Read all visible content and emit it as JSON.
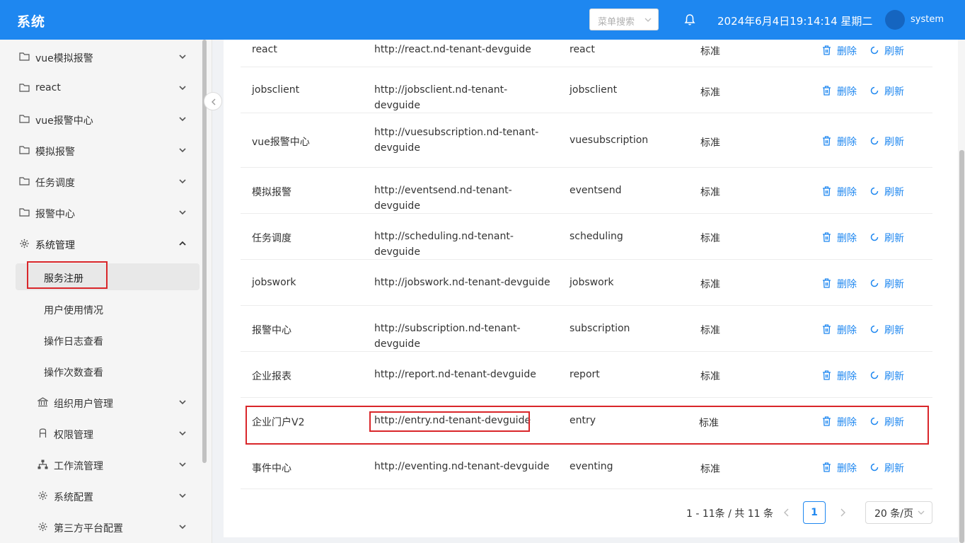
{
  "header": {
    "brand": "系统",
    "menu_search_placeholder": "菜单搜索",
    "datetime": "2024年6月4日19:14:14 星期二",
    "username": "system"
  },
  "sidebar": {
    "items": [
      {
        "label": "vue模拟报警"
      },
      {
        "label": "react"
      },
      {
        "label": "vue报警中心"
      },
      {
        "label": "模拟报警"
      },
      {
        "label": "任务调度"
      },
      {
        "label": "报警中心"
      },
      {
        "label": "系统管理"
      },
      {
        "label": "服务注册"
      },
      {
        "label": "用户使用情况"
      },
      {
        "label": "操作日志查看"
      },
      {
        "label": "操作次数查看"
      },
      {
        "label": "组织用户管理"
      },
      {
        "label": "权限管理"
      },
      {
        "label": "工作流管理"
      },
      {
        "label": "系统配置"
      },
      {
        "label": "第三方平台配置"
      }
    ]
  },
  "table": {
    "rows": [
      {
        "name": "react",
        "url": "http://react.nd-tenant-devguide",
        "code": "react",
        "type": "标准"
      },
      {
        "name": "jobsclient",
        "url": "http://jobsclient.nd-tenant-devguide",
        "code": "jobsclient",
        "type": "标准"
      },
      {
        "name": "vue报警中心",
        "url": "http://vuesubscription.nd-tenant-devguide",
        "code": "vuesubscription",
        "type": "标准"
      },
      {
        "name": "模拟报警",
        "url": "http://eventsend.nd-tenant-devguide",
        "code": "eventsend",
        "type": "标准"
      },
      {
        "name": "任务调度",
        "url": "http://scheduling.nd-tenant-devguide",
        "code": "scheduling",
        "type": "标准"
      },
      {
        "name": "jobswork",
        "url": "http://jobswork.nd-tenant-devguide",
        "code": "jobswork",
        "type": "标准"
      },
      {
        "name": "报警中心",
        "url": "http://subscription.nd-tenant-devguide",
        "code": "subscription",
        "type": "标准"
      },
      {
        "name": "企业报表",
        "url": "http://report.nd-tenant-devguide",
        "code": "report",
        "type": "标准"
      },
      {
        "name": "企业门户V2",
        "url": "http://entry.nd-tenant-devguide",
        "code": "entry",
        "type": "标准"
      },
      {
        "name": "事件中心",
        "url": "http://eventing.nd-tenant-devguide",
        "code": "eventing",
        "type": "标准"
      }
    ],
    "delete_label": "删除",
    "refresh_label": "刷新"
  },
  "pagination": {
    "total_text": "1 - 11条 / 共 11 条",
    "current_page": "1",
    "page_size": "20 条/页"
  },
  "colors": {
    "primary": "#1e87f0",
    "highlight_border": "#d9262a"
  },
  "icons": [
    "bell-icon",
    "folder-icon",
    "gear-icon",
    "bank-icon",
    "user-icon",
    "sitemap-icon",
    "trash-icon",
    "refresh-icon",
    "chevron-down-icon",
    "chevron-up-icon",
    "chevron-left-icon",
    "chevron-right-icon"
  ]
}
